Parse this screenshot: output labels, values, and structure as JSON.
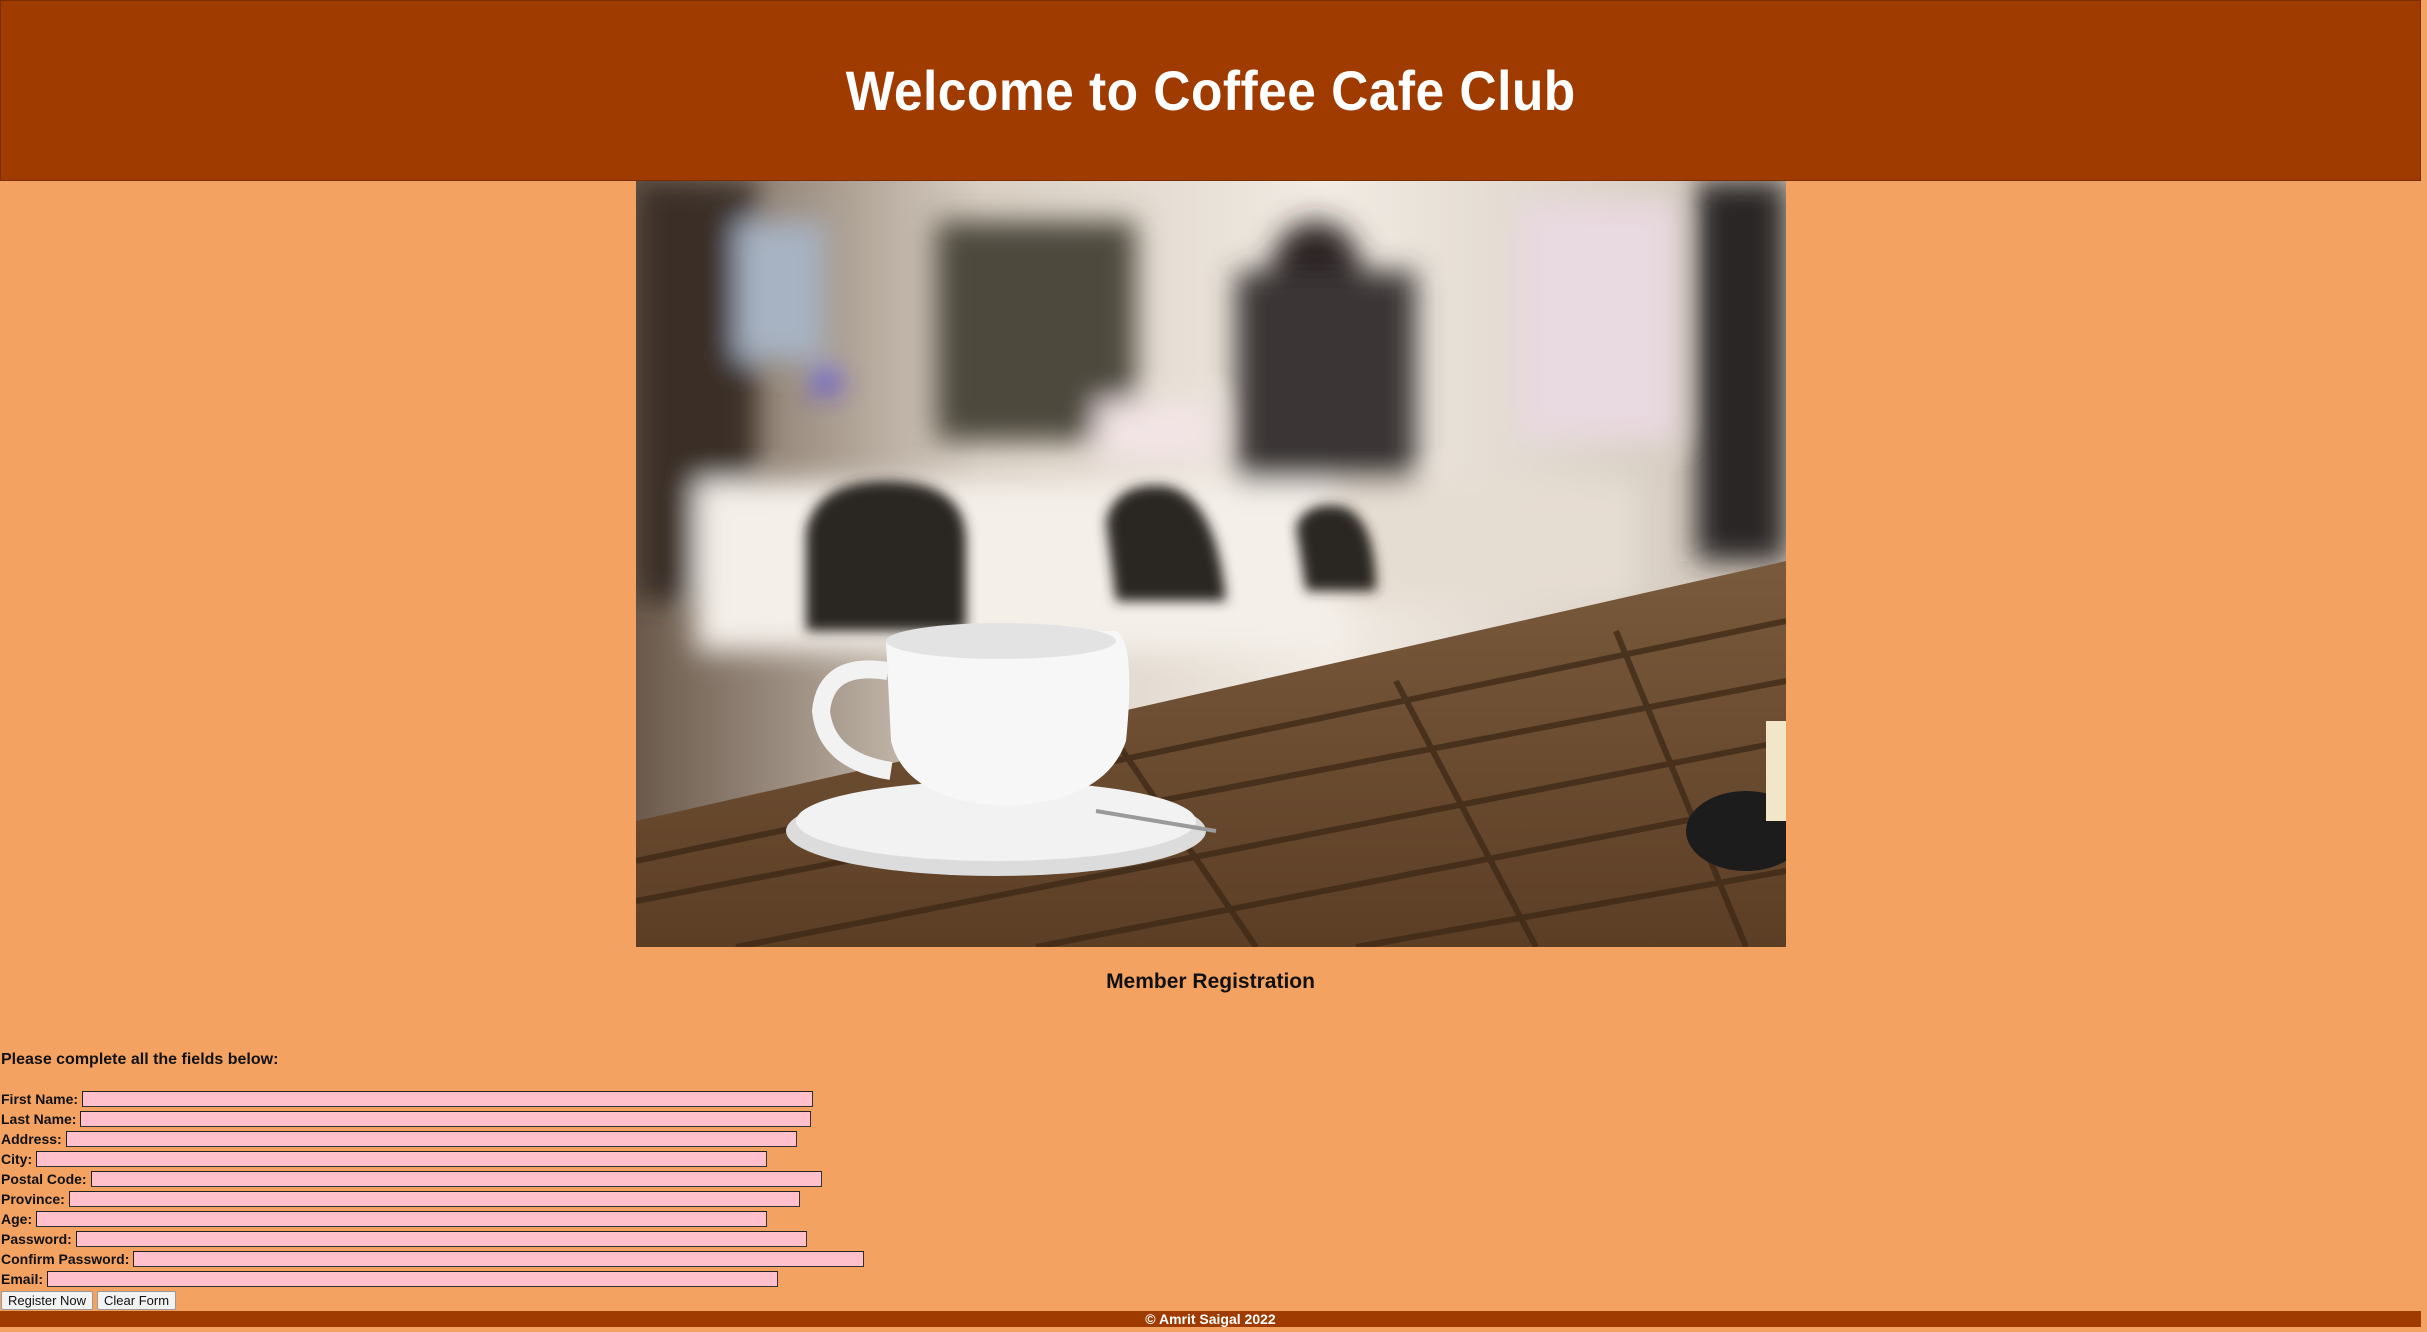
{
  "header": {
    "title": "Welcome to Coffee Cafe Club"
  },
  "registration": {
    "title": "Member Registration",
    "instructions": "Please complete all the fields below:",
    "fields": [
      {
        "label": "First Name:"
      },
      {
        "label": "Last Name:"
      },
      {
        "label": "Address:"
      },
      {
        "label": "City:"
      },
      {
        "label": "Postal Code:"
      },
      {
        "label": "Province:"
      },
      {
        "label": "Age:"
      },
      {
        "label": "Password:"
      },
      {
        "label": "Confirm Password:"
      },
      {
        "label": "Email:"
      }
    ],
    "register_label": "Register Now",
    "clear_label": "Clear Form"
  },
  "footer": {
    "text": "© Amrit Saigal 2022"
  },
  "colors": {
    "background": "#f4a261",
    "header": "#a03b00",
    "input": "#ffc0cb"
  }
}
